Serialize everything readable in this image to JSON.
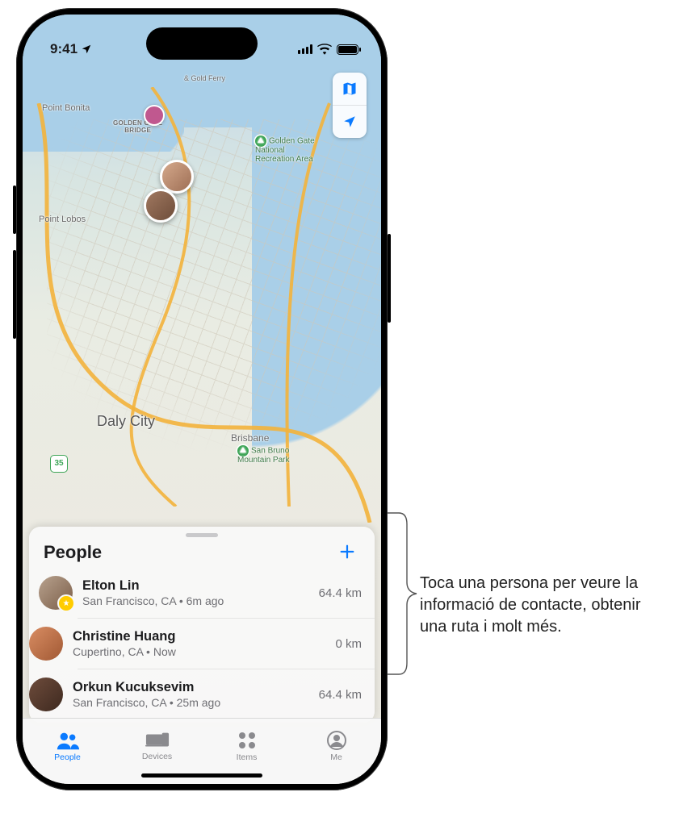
{
  "status": {
    "time": "9:41"
  },
  "map": {
    "labels": {
      "point_bonita": "Point Bonita",
      "golden_gate_bridge": "GOLDEN GATE\nBRIDGE",
      "ferry": "& Gold Ferry",
      "gg_rec": "Golden Gate\nNational\nRecreation Area",
      "point_lobos": "Point Lobos",
      "daly_city": "Daly City",
      "brisbane": "Brisbane",
      "sb_park": "San Bruno\nMountain Park",
      "shield_35": "35"
    },
    "controls": {
      "mode_icon": "map-mode-icon",
      "locate_icon": "locate-icon"
    }
  },
  "sheet": {
    "title": "People",
    "add_icon": "plus-icon",
    "people": [
      {
        "name": "Elton Lin",
        "subtitle": "San Francisco, CA • 6m ago",
        "distance": "64.4 km",
        "starred": true
      },
      {
        "name": "Christine Huang",
        "subtitle": "Cupertino, CA • Now",
        "distance": "0 km",
        "starred": false
      },
      {
        "name": "Orkun Kucuksevim",
        "subtitle": "San Francisco, CA • 25m ago",
        "distance": "64.4 km",
        "starred": false
      }
    ]
  },
  "tabs": {
    "people": "People",
    "devices": "Devices",
    "items": "Items",
    "me": "Me"
  },
  "annotation": {
    "text": "Toca una persona per veure la informació de contacte, obtenir una ruta i molt més."
  }
}
